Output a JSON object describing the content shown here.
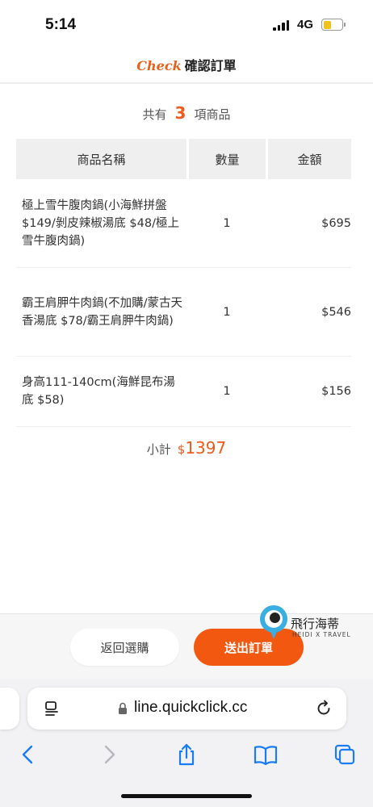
{
  "status": {
    "time": "5:14",
    "network": "4G"
  },
  "header": {
    "brand": "Check",
    "title": "確認訂單"
  },
  "summary": {
    "prefix": "共有",
    "count": "3",
    "suffix": "項商品"
  },
  "table": {
    "columns": [
      "商品名稱",
      "數量",
      "金額"
    ],
    "rows": [
      {
        "name": "極上雪牛腹肉鍋(小海鮮拼盤 $149/剝皮辣椒湯底 $48/極上雪牛腹肉鍋)",
        "qty": "1",
        "amount": "$695"
      },
      {
        "name": "霸王肩胛牛肉鍋(不加購/蒙古天香湯底 $78/霸王肩胛牛肉鍋)",
        "qty": "1",
        "amount": "$546"
      },
      {
        "name": "身高111-140cm(海鮮昆布湯底 $58)",
        "qty": "1",
        "amount": "$156"
      }
    ]
  },
  "subtotal": {
    "label": "小計",
    "currency": "$",
    "amount": "1397"
  },
  "actions": {
    "back": "返回選購",
    "submit": "送出訂單"
  },
  "watermark": {
    "title": "飛行海蒂",
    "subtitle": "HEIDI X TRAVEL"
  },
  "browser": {
    "url": "line.quickclick.cc"
  },
  "colors": {
    "accent": "#f2580f",
    "brand": "#e8611a",
    "header_bg": "#efefef",
    "pin": "#3aaee0"
  }
}
